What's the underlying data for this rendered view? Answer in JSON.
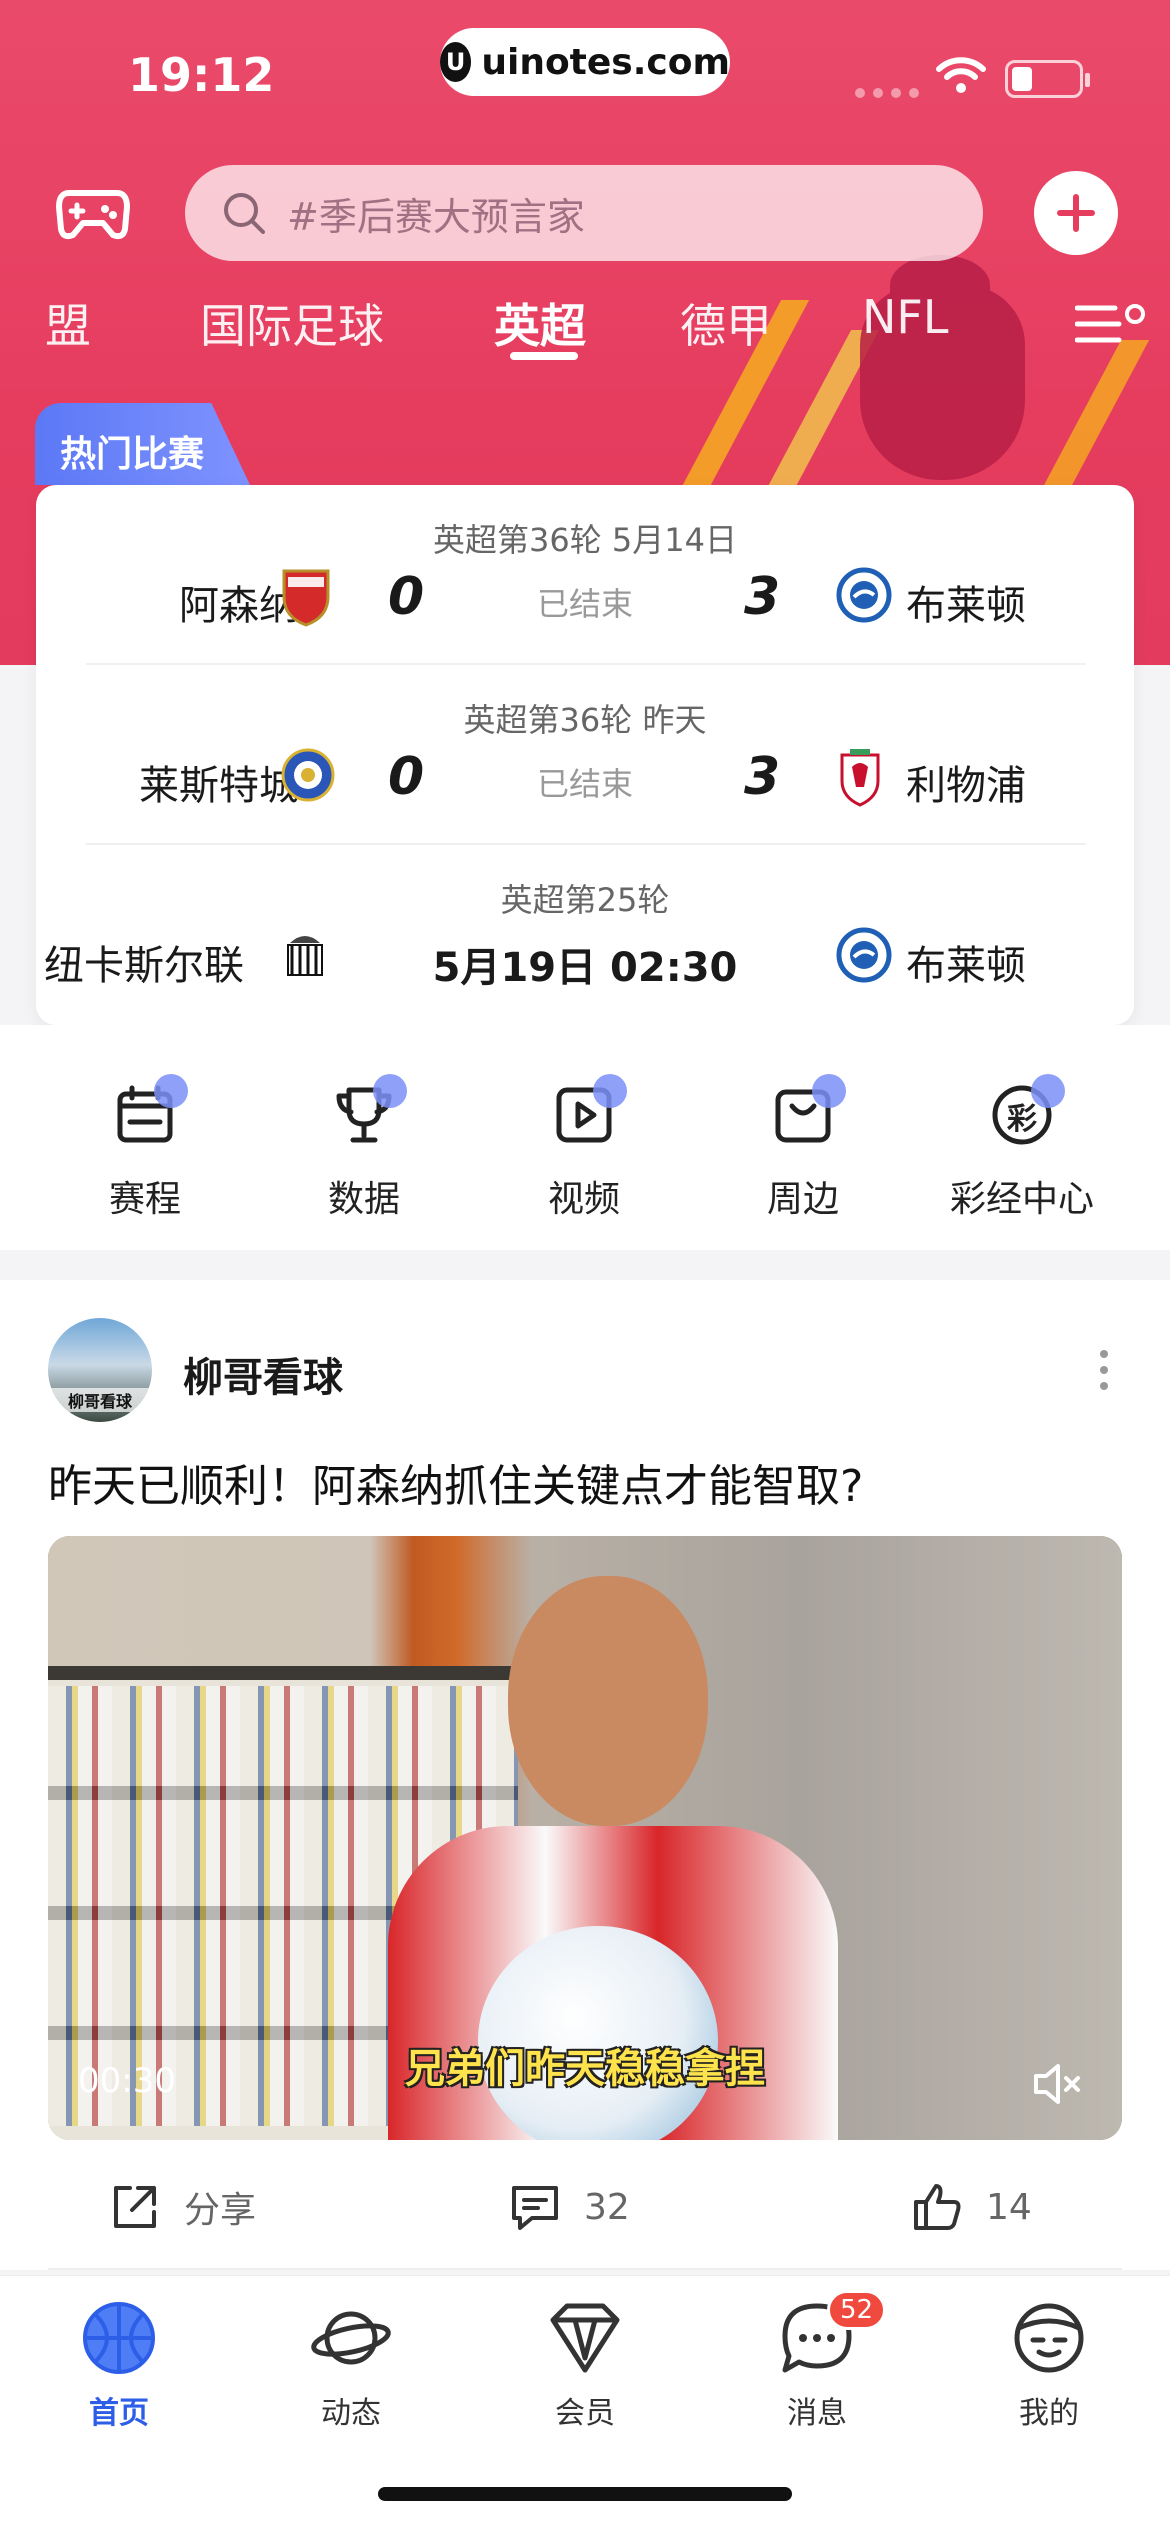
{
  "status_bar": {
    "time": "19:12",
    "site": "uinotes.com"
  },
  "search": {
    "placeholder": "#季后赛大预言家"
  },
  "tabs": [
    {
      "label": "盟",
      "active": false
    },
    {
      "label": "国际足球",
      "active": false
    },
    {
      "label": "英超",
      "active": true
    },
    {
      "label": "德甲",
      "active": false
    },
    {
      "label": "NFL",
      "active": false
    }
  ],
  "hot": {
    "label": "热门比赛"
  },
  "matches": [
    {
      "meta": "英超第36轮  5月14日",
      "home": "阿森纳",
      "home_score": "0",
      "status": "已结束",
      "away_score": "3",
      "away": "布莱顿"
    },
    {
      "meta": "英超第36轮  昨天",
      "home": "莱斯特城",
      "home_score": "0",
      "status": "已结束",
      "away_score": "3",
      "away": "利物浦"
    },
    {
      "meta": "英超第25轮",
      "home": "纽卡斯尔联",
      "kickoff": "5月19日 02:30",
      "away": "布莱顿"
    }
  ],
  "quick": [
    {
      "label": "赛程",
      "icon": "calendar-icon"
    },
    {
      "label": "数据",
      "icon": "trophy-icon"
    },
    {
      "label": "视频",
      "icon": "video-icon"
    },
    {
      "label": "周边",
      "icon": "bag-icon"
    },
    {
      "label": "彩经中心",
      "icon": "lottery-icon",
      "glyph": "彩"
    }
  ],
  "post": {
    "author": "柳哥看球",
    "avatar_tag": "柳哥看球",
    "title": "昨天已顺利！阿森纳抓住关键点才能智取?",
    "caption": "兄弟们昨天稳稳拿捏",
    "duration": "00:30",
    "share": "分享",
    "comments": "32",
    "likes": "14"
  },
  "tabbar": [
    {
      "label": "首页",
      "active": true
    },
    {
      "label": "动态",
      "active": false
    },
    {
      "label": "会员",
      "active": false
    },
    {
      "label": "消息",
      "active": false,
      "badge": "52"
    },
    {
      "label": "我的",
      "active": false
    }
  ],
  "colors": {
    "brand": "#e63d5f",
    "accent": "#2d5ee8",
    "badge": "#f0493d"
  }
}
